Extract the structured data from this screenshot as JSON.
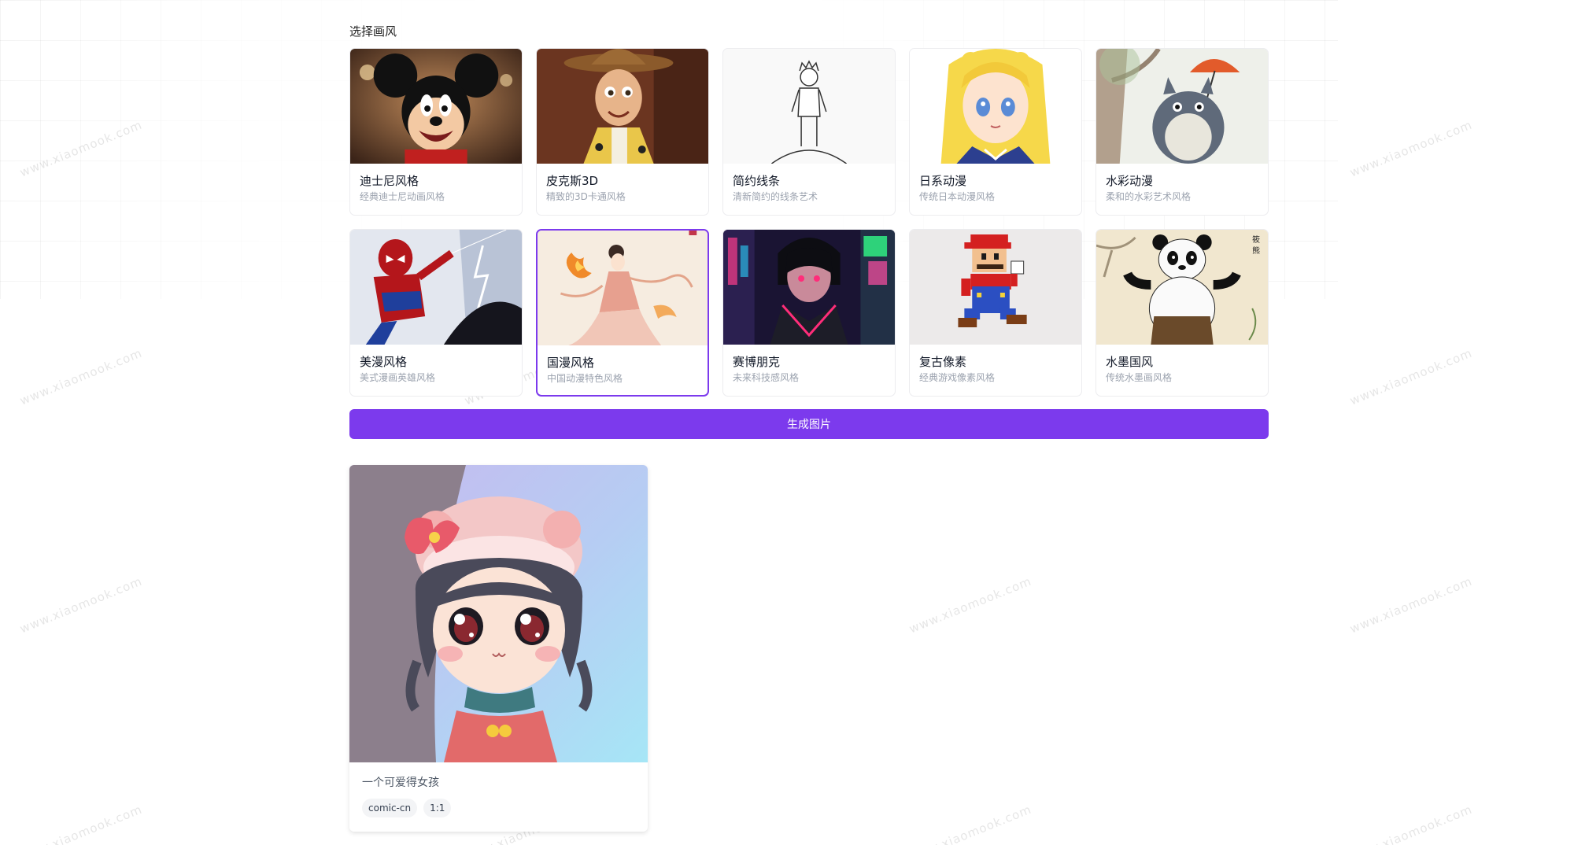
{
  "style_section": {
    "title": "选择画风",
    "selected_index": 6,
    "styles": [
      {
        "name": "迪士尼风格",
        "desc": "经典迪士尼动画风格"
      },
      {
        "name": "皮克斯3D",
        "desc": "精致的3D卡通风格"
      },
      {
        "name": "简约线条",
        "desc": "清新简约的线条艺术"
      },
      {
        "name": "日系动漫",
        "desc": "传统日本动漫风格"
      },
      {
        "name": "水彩动漫",
        "desc": "柔和的水彩艺术风格"
      },
      {
        "name": "美漫风格",
        "desc": "美式漫画英雄风格"
      },
      {
        "name": "国漫风格",
        "desc": "中国动漫特色风格"
      },
      {
        "name": "赛博朋克",
        "desc": "未来科技感风格"
      },
      {
        "name": "复古像素",
        "desc": "经典游戏像素风格"
      },
      {
        "name": "水墨国风",
        "desc": "传统水墨画风格"
      }
    ]
  },
  "generate_button": {
    "label": "生成图片"
  },
  "result": {
    "prompt": "一个可爱得女孩",
    "tags": [
      "comic-cn",
      "1:1"
    ]
  },
  "watermark": {
    "text": "www.xiaomook.com"
  },
  "colors": {
    "accent": "#7c3aed",
    "card_border": "#ececef",
    "muted_text": "#9ca3af"
  }
}
